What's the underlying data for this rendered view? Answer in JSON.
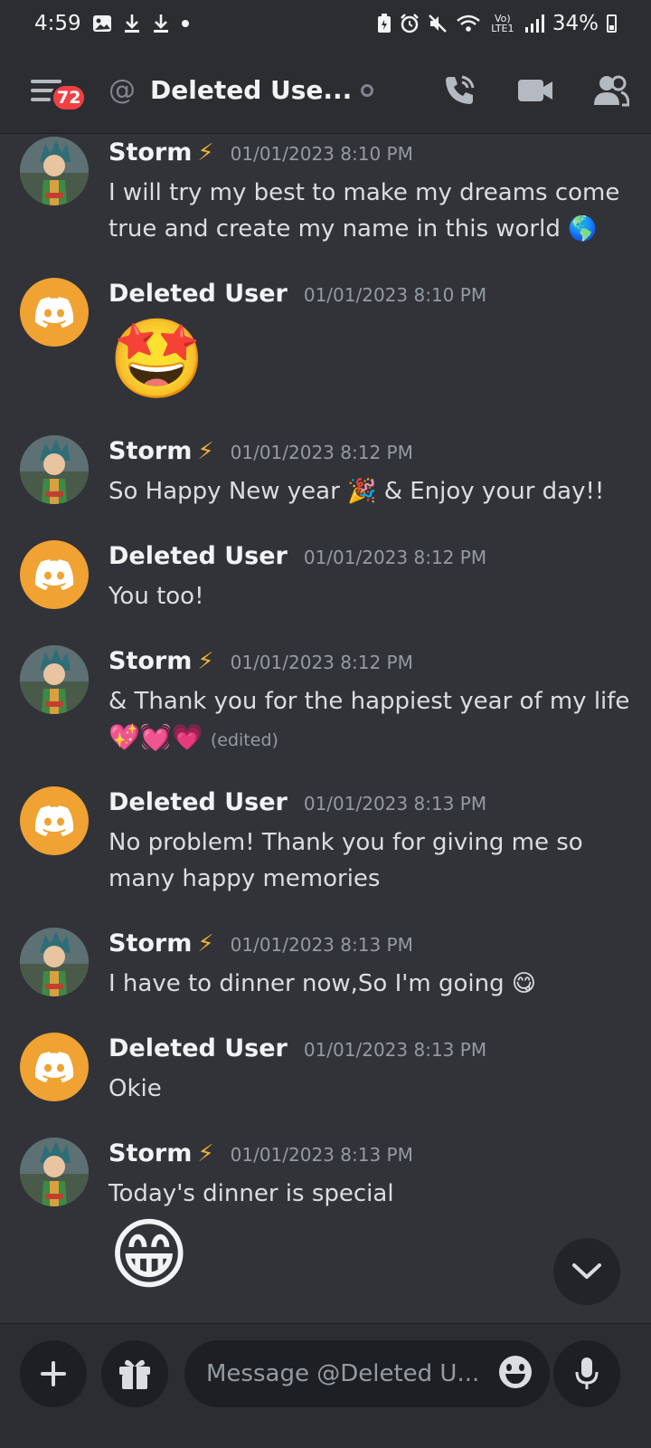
{
  "status_bar": {
    "time": "4:59",
    "battery": "34%",
    "network": "Vo) LTE1",
    "left_icons": [
      "image-icon",
      "download-icon",
      "download-icon",
      "dot-icon"
    ],
    "right_icons": [
      "battery-saver-icon",
      "alarm-icon",
      "mute-icon",
      "wifi-icon",
      "signal-icon",
      "battery-icon"
    ]
  },
  "header": {
    "menu_badge": "72",
    "title": "Deleted Use...",
    "actions": [
      "call-icon",
      "video-icon",
      "members-icon"
    ]
  },
  "messages": [
    {
      "author": "Storm",
      "badge": "⚡",
      "time": "01/01/2023 8:10 PM",
      "lines": [
        "I will try my best to make my dreams come",
        "true and create my name in this world 🌎"
      ],
      "avatar": "storm"
    },
    {
      "author": "Deleted User",
      "time": "01/01/2023 8:10 PM",
      "big_emoji": "🤩",
      "avatar": "discord"
    },
    {
      "author": "Storm",
      "badge": "⚡",
      "time": "01/01/2023 8:12 PM",
      "lines": [
        "So Happy New year 🎉 & Enjoy your day!!"
      ],
      "avatar": "storm"
    },
    {
      "author": "Deleted User",
      "time": "01/01/2023 8:12 PM",
      "lines": [
        "You too!"
      ],
      "avatar": "discord"
    },
    {
      "author": "Storm",
      "badge": "⚡",
      "time": "01/01/2023 8:12 PM",
      "lines": [
        "& Thank you for the happiest year of my life",
        "💖💓💗"
      ],
      "edited": "(edited)",
      "avatar": "storm"
    },
    {
      "author": "Deleted User",
      "time": "01/01/2023 8:13 PM",
      "lines": [
        "No problem! Thank you for giving me so",
        "many happy memories"
      ],
      "avatar": "discord"
    },
    {
      "author": "Storm",
      "badge": "⚡",
      "time": "01/01/2023 8:13 PM",
      "lines": [
        "I have to dinner now,So I'm going 😋"
      ],
      "avatar": "storm"
    },
    {
      "author": "Deleted User",
      "time": "01/01/2023 8:13 PM",
      "lines": [
        "Okie"
      ],
      "avatar": "discord"
    },
    {
      "author": "Storm",
      "badge": "⚡",
      "time": "01/01/2023 8:13 PM",
      "lines": [
        "Today's dinner is special"
      ],
      "big_emoji": "😁",
      "avatar": "storm"
    }
  ],
  "composer": {
    "placeholder": "Message @Deleted U..."
  },
  "colors": {
    "background": "#313338",
    "header": "#2b2d31",
    "discord_avatar": "#f0a232",
    "badge_red": "#f23f43",
    "input": "#1e1f22"
  }
}
